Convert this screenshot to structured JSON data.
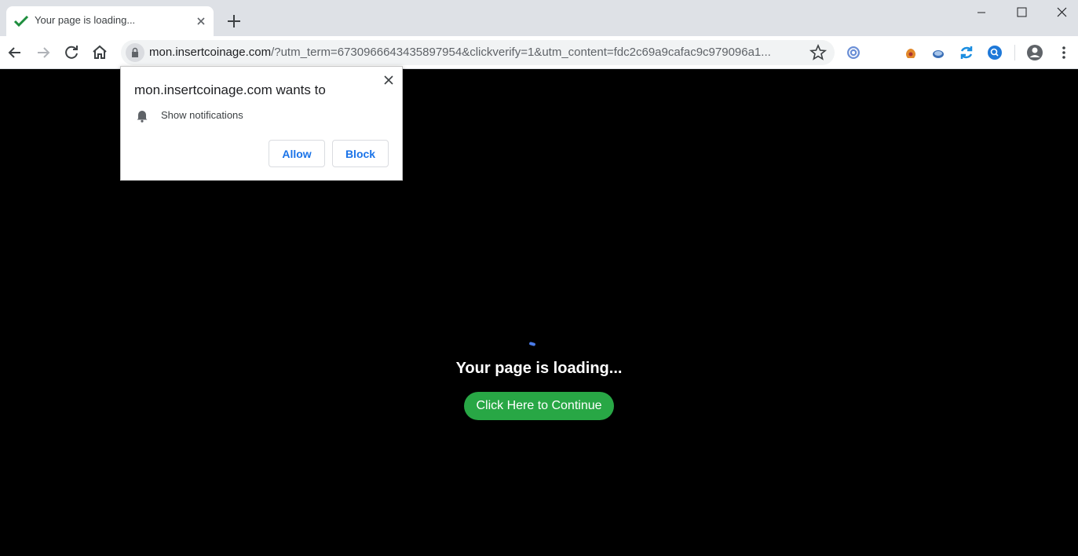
{
  "tab": {
    "title": "Your page is loading..."
  },
  "omnibox": {
    "host": "mon.insertcoinage.com",
    "rest": "/?utm_term=6730966643435897954&clickverify=1&utm_content=fdc2c69a9cafac9c979096a1..."
  },
  "popup": {
    "title": "mon.insertcoinage.com wants to",
    "permission": "Show notifications",
    "allow_label": "Allow",
    "block_label": "Block"
  },
  "page": {
    "loading_text": "Your page is loading...",
    "continue_label": "Click Here to Continue"
  },
  "colors": {
    "continue_button": "#28a745",
    "spinner": "#4a7be8",
    "link_blue": "#1a73e8"
  }
}
